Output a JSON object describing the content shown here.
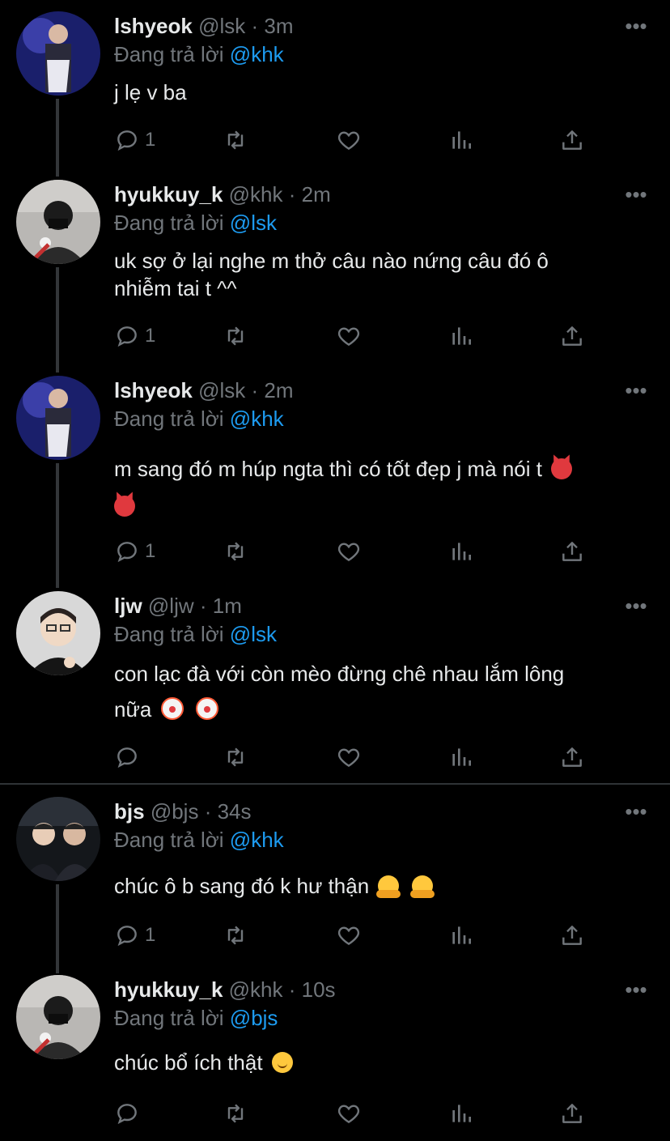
{
  "colors": {
    "background": "#000000",
    "text": "#e7e9ea",
    "secondary": "#71767b",
    "mention": "#1d9bf0",
    "thread_line": "#333639"
  },
  "tweets": [
    {
      "name": "lshyeok",
      "handle": "@lsk",
      "dot": "·",
      "time": "3m",
      "reply_prefix": "Đang trả lời",
      "reply_to": "@khk",
      "line1": "j lẹ v ba",
      "line2": "",
      "reply_count": "1",
      "avatar": "lshyeok-avatar"
    },
    {
      "name": "hyukkuy_k",
      "handle": "@khk",
      "dot": "·",
      "time": "2m",
      "reply_prefix": "Đang trả lời",
      "reply_to": "@lsk",
      "line1": "uk sợ ở lại nghe m thở câu nào nứng câu đó ô",
      "line2": "nhiễm tai t ^^",
      "reply_count": "1",
      "avatar": "hyukkuy-avatar"
    },
    {
      "name": "lshyeok",
      "handle": "@lsk",
      "dot": "·",
      "time": "2m",
      "reply_prefix": "Đang trả lời",
      "reply_to": "@khk",
      "line1": "m sang đó m húp ngta thì có tốt đẹp j mà nói t",
      "line2": "",
      "reply_count": "1",
      "avatar": "lshyeok-avatar"
    },
    {
      "name": "ljw",
      "handle": "@ljw",
      "dot": "·",
      "time": "1m",
      "reply_prefix": "Đang trả lời",
      "reply_to": "@lsk",
      "line1": "con lạc đà với còn mèo đừng chê nhau lắm lông",
      "line2": "nữa",
      "reply_count": "",
      "avatar": "ljw-avatar"
    },
    {
      "name": "bjs",
      "handle": "@bjs",
      "dot": "·",
      "time": "34s",
      "reply_prefix": "Đang trả lời",
      "reply_to": "@khk",
      "line1": "chúc ô b sang đó k hư thận",
      "line2": "",
      "reply_count": "1",
      "avatar": "bjs-avatar"
    },
    {
      "name": "hyukkuy_k",
      "handle": "@khk",
      "dot": "·",
      "time": "10s",
      "reply_prefix": "Đang trả lời",
      "reply_to": "@bjs",
      "line1": "chúc bổ ích thật",
      "line2": "",
      "reply_count": "",
      "avatar": "hyukkuy-avatar"
    }
  ],
  "more_label": "•••"
}
